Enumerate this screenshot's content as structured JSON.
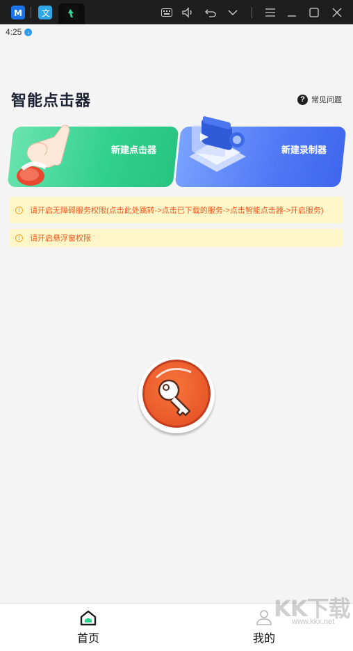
{
  "window": {
    "icons": [
      "app-icon-m",
      "app-icon-translate",
      "app-icon-clicker"
    ],
    "controls": [
      "keyboard-icon",
      "volume-icon",
      "undo-icon",
      "chevron-down-icon",
      "menu-icon",
      "minimize-icon",
      "maximize-icon",
      "close-icon"
    ]
  },
  "status_bar": {
    "time": "4:25"
  },
  "header": {
    "title": "智能点击器",
    "faq_label": "常见问题"
  },
  "cards": {
    "new_clicker": "新建点击器",
    "new_recorder": "新建录制器"
  },
  "notices": [
    "请开启无障碍服务权限(点击此处跳转->点击已下载的服务->点击智能点击器->开启服务)",
    "请开启悬浮窗权限"
  ],
  "nav": {
    "home": "首页",
    "mine": "我的"
  },
  "watermark": {
    "text": "KK下载",
    "url": "www.kkx.net"
  },
  "colors": {
    "accent_green": "#2fcf8c",
    "accent_blue": "#5078f5",
    "notice_bg": "#fdf6c8",
    "notice_text": "#f2561d",
    "fab": "#e9582a"
  }
}
